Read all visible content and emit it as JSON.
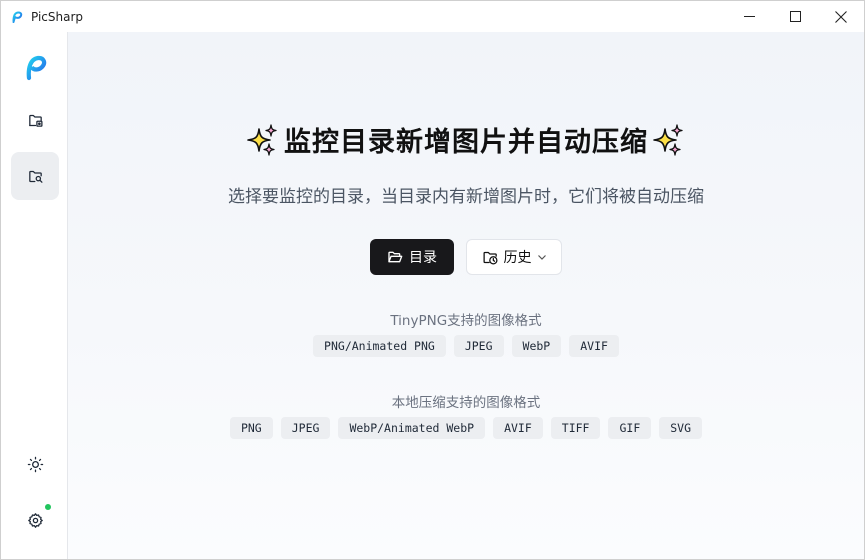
{
  "window": {
    "title": "PicSharp",
    "controls": [
      "minimize-icon",
      "maximize-icon",
      "close-icon"
    ]
  },
  "sidebar": {
    "items": [
      {
        "name": "compress-folder",
        "icon": "folder-image-icon",
        "active": false
      },
      {
        "name": "watch-folder",
        "icon": "folder-search-icon",
        "active": true
      }
    ],
    "bottom": [
      {
        "name": "theme-toggle",
        "icon": "sun-icon"
      },
      {
        "name": "settings",
        "icon": "gear-icon",
        "badge_color": "#22c55e"
      }
    ]
  },
  "main": {
    "title": "监控目录新增图片并自动压缩",
    "subtitle": "选择要监控的目录，当目录内有新增图片时，它们将被自动压缩",
    "folder_button": "目录",
    "history_button": "历史",
    "tinypng_heading": "TinyPNG支持的图像格式",
    "tinypng_formats": [
      "PNG/Animated PNG",
      "JPEG",
      "WebP",
      "AVIF"
    ],
    "local_heading": "本地压缩支持的图像格式",
    "local_formats": [
      "PNG",
      "JPEG",
      "WebP/Animated WebP",
      "AVIF",
      "TIFF",
      "GIF",
      "SVG"
    ]
  },
  "colors": {
    "primary_button": "#18181b",
    "accent_gradient_start": "#00c2ff",
    "accent_gradient_end": "#2563eb",
    "status_dot": "#22c55e"
  }
}
